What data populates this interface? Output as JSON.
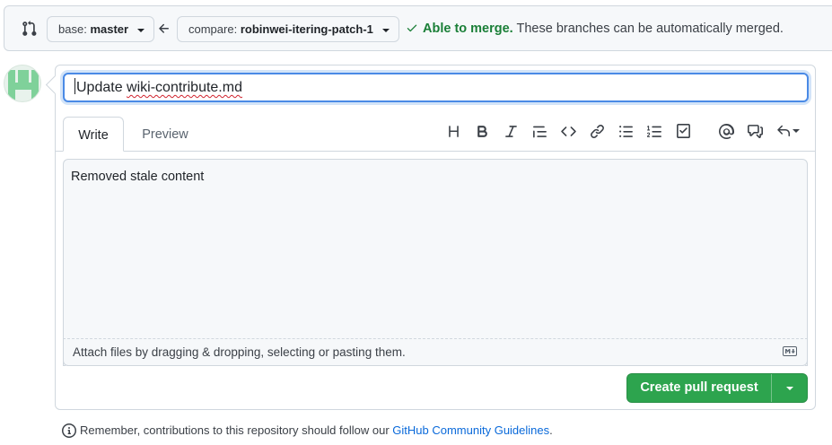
{
  "compare_bar": {
    "base_prefix": "base:",
    "base_branch": "master",
    "compare_prefix": "compare:",
    "compare_branch": "robinwei-itering-patch-1",
    "merge_ok": "Able to merge.",
    "merge_text": "These branches can be automatically merged."
  },
  "form": {
    "title_value_part1": "Update ",
    "title_value_part2": "wiki-contribute.md",
    "tabs": [
      {
        "label": "Write"
      },
      {
        "label": "Preview"
      }
    ],
    "toolbar_icons": [
      "heading-icon",
      "bold-icon",
      "italic-icon",
      "quote-icon",
      "code-icon",
      "link-icon",
      "unordered-list-icon",
      "ordered-list-icon",
      "task-list-icon",
      "mention-icon",
      "reference-icon",
      "reply-icon"
    ],
    "body": "Removed stale content",
    "attach_hint": "Attach files by dragging & dropping, selecting or pasting them."
  },
  "create_button": {
    "label": "Create pull request"
  },
  "footer": {
    "prefix": "Remember, contributions to this repository should follow our ",
    "link": "GitHub Community Guidelines",
    "suffix": "."
  },
  "colors": {
    "accent_green": "#2da44e",
    "merge_green": "#1a7f37",
    "link_blue": "#0969da",
    "focus_blue": "#4a8ae6"
  }
}
